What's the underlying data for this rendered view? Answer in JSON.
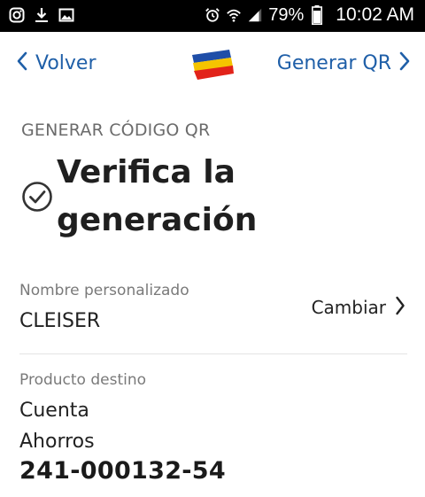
{
  "status_bar": {
    "left_icons": [
      "instagram-icon",
      "download-icon",
      "image-icon"
    ],
    "right_icons": [
      "alarm-icon",
      "wifi-icon",
      "signal-icon"
    ],
    "battery_percent": "79%",
    "time": "10:02 AM"
  },
  "nav": {
    "back_label": "Volver",
    "next_label": "Generar QR",
    "logo_colors": [
      "#1f4ea8",
      "#f5c400",
      "#e2231a"
    ],
    "accent": "#1f5fa8"
  },
  "main": {
    "section_title": "GENERAR CÓDIGO QR",
    "headline_line1": "Verifica la",
    "headline_line2": "generación",
    "custom_name": {
      "label": "Nombre personalizado",
      "value": "CLEISER",
      "change_label": "Cambiar"
    },
    "destination": {
      "label": "Producto destino",
      "type_line1": "Cuenta",
      "type_line2": "Ahorros",
      "account_number": "241-000132-54"
    }
  }
}
